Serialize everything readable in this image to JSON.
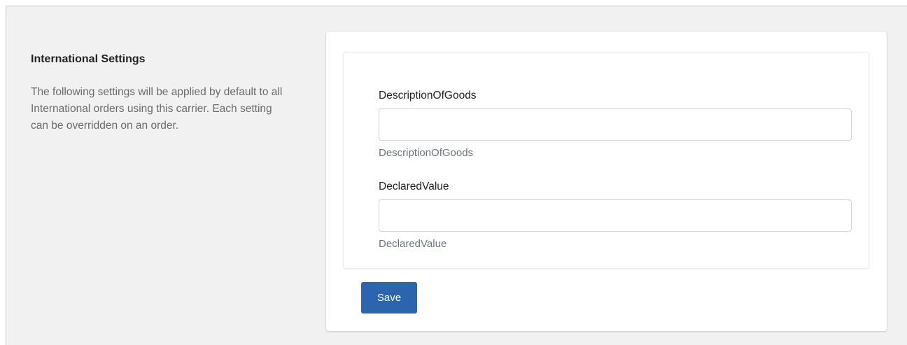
{
  "section": {
    "title": "International Settings",
    "description": "The following settings will be applied by default to all International orders using this carrier. Each setting can be overridden on an order."
  },
  "fields": [
    {
      "label": "DescriptionOfGoods",
      "value": "",
      "help": "DescriptionOfGoods"
    },
    {
      "label": "DeclaredValue",
      "value": "",
      "help": "DeclaredValue"
    }
  ],
  "actions": {
    "save_label": "Save"
  },
  "colors": {
    "primary": "#2d64ae",
    "page_background": "#f1f1f1",
    "help_text": "#6c757d"
  }
}
